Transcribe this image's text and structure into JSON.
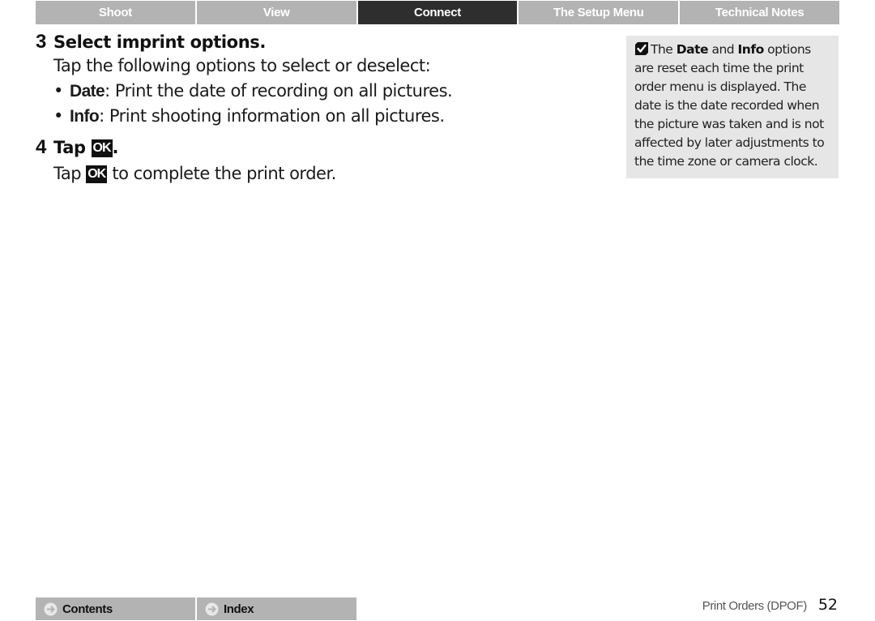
{
  "tabs": [
    {
      "label": "Shoot",
      "active": false
    },
    {
      "label": "View",
      "active": false
    },
    {
      "label": "Connect",
      "active": true
    },
    {
      "label": "The Setup Menu",
      "active": false
    },
    {
      "label": "Technical Notes",
      "active": false
    }
  ],
  "steps": [
    {
      "number": "3",
      "title": "Select imprint options.",
      "intro": "Tap the following options to select or deselect:",
      "bullets": [
        {
          "term": "Date",
          "text": ": Print the date of recording on all pictures."
        },
        {
          "term": "Info",
          "text": ": Print shooting information on all pictures."
        }
      ]
    },
    {
      "number": "4",
      "title_prefix": "Tap ",
      "title_suffix": ".",
      "body_prefix": "Tap ",
      "body_suffix": " to complete the print order.",
      "button_glyph": "OK"
    }
  ],
  "note": {
    "icon": "check-icon",
    "part1": "The ",
    "term1": "Date",
    "part2": " and ",
    "term2": "Info",
    "part3": " options are reset each time the print order menu is displayed. The date is the date recorded when the picture was taken and is not affected by later adjustments to the time zone or camera clock."
  },
  "footer": {
    "contents_label": "Contents",
    "index_label": "Index",
    "section_name": "Print Orders (DPOF)",
    "page_number": "52"
  },
  "colors": {
    "tab_bg": "#b3b3b3",
    "tab_active_bg": "#2e2e2e",
    "note_bg": "#e6e6e6"
  }
}
